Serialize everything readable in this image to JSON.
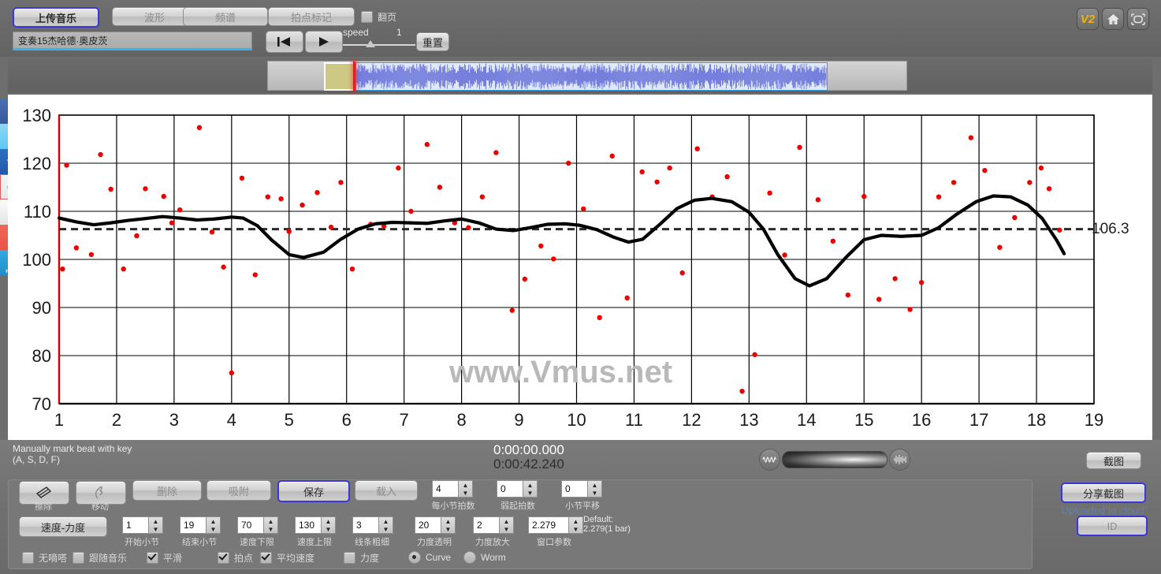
{
  "toolbar": {
    "buttons": [
      {
        "label": "上传音乐",
        "selected": true
      },
      {
        "label": "波形",
        "selected": false
      },
      {
        "label": "频谱",
        "selected": false
      },
      {
        "label": "拍点标记",
        "selected": false
      }
    ],
    "flip_checkbox": {
      "label": "翻页",
      "checked": false
    },
    "title_value": "变奏15杰哈德·奥皮茨",
    "speed_label": "speed",
    "speed_value": "1",
    "reset_label": "重置",
    "right_icons": [
      "v2-badge",
      "home-icon",
      "fullscreen-icon"
    ]
  },
  "social": [
    {
      "name": "facebook-icon",
      "glyph": "f"
    },
    {
      "name": "twitter-icon",
      "glyph": "t"
    },
    {
      "name": "qzone-icon",
      "glyph": "★"
    },
    {
      "name": "weibo-icon",
      "glyph": "◉"
    },
    {
      "name": "email-icon",
      "glyph": "✉"
    },
    {
      "name": "share-plus-icon",
      "glyph": "+"
    },
    {
      "name": "help-icon",
      "glyph": "?",
      "sub": "HELP"
    }
  ],
  "chart_data": {
    "type": "scatter",
    "title": "",
    "xlabel": "",
    "ylabel": "",
    "watermark": "www.Vmus.net",
    "xlim": [
      1,
      19
    ],
    "ylim": [
      70,
      130
    ],
    "xticks": [
      1,
      2,
      3,
      4,
      5,
      6,
      7,
      8,
      9,
      10,
      11,
      12,
      13,
      14,
      15,
      16,
      17,
      18,
      19
    ],
    "yticks": [
      70,
      80,
      90,
      100,
      110,
      120,
      130
    ],
    "grid": true,
    "average_line": {
      "value": 106.3,
      "label": "106.3",
      "style": "dashed"
    },
    "series": [
      {
        "name": "beat-tempo-points",
        "type": "scatter",
        "color": "#ee0000",
        "points": [
          [
            1.06,
            98.0
          ],
          [
            1.13,
            119.6
          ],
          [
            1.3,
            102.4
          ],
          [
            1.56,
            101.0
          ],
          [
            1.72,
            121.8
          ],
          [
            1.9,
            114.6
          ],
          [
            2.12,
            98.0
          ],
          [
            2.35,
            104.9
          ],
          [
            2.5,
            114.7
          ],
          [
            2.82,
            113.1
          ],
          [
            2.96,
            107.6
          ],
          [
            3.1,
            110.3
          ],
          [
            3.44,
            127.4
          ],
          [
            3.66,
            105.7
          ],
          [
            3.86,
            98.4
          ],
          [
            4.0,
            76.4
          ],
          [
            4.18,
            116.9
          ],
          [
            4.41,
            96.8
          ],
          [
            4.63,
            113.0
          ],
          [
            4.86,
            112.6
          ],
          [
            5.0,
            105.8
          ],
          [
            5.23,
            111.3
          ],
          [
            5.49,
            113.9
          ],
          [
            5.73,
            106.7
          ],
          [
            5.9,
            116.0
          ],
          [
            6.1,
            98.0
          ],
          [
            6.42,
            107.3
          ],
          [
            6.65,
            106.9
          ],
          [
            6.9,
            119.0
          ],
          [
            7.12,
            110.0
          ],
          [
            7.4,
            123.9
          ],
          [
            7.62,
            115.0
          ],
          [
            7.88,
            107.6
          ],
          [
            8.12,
            106.6
          ],
          [
            8.36,
            113.0
          ],
          [
            8.6,
            122.2
          ],
          [
            8.88,
            89.4
          ],
          [
            9.1,
            95.9
          ],
          [
            9.38,
            102.8
          ],
          [
            9.6,
            100.1
          ],
          [
            9.86,
            120.0
          ],
          [
            10.12,
            110.5
          ],
          [
            10.4,
            87.9
          ],
          [
            10.62,
            121.5
          ],
          [
            10.88,
            92.0
          ],
          [
            11.14,
            118.2
          ],
          [
            11.4,
            116.1
          ],
          [
            11.62,
            119.0
          ],
          [
            11.84,
            97.2
          ],
          [
            12.1,
            123.0
          ],
          [
            12.36,
            113.0
          ],
          [
            12.62,
            117.2
          ],
          [
            12.88,
            72.6
          ],
          [
            13.1,
            80.2
          ],
          [
            13.36,
            113.8
          ],
          [
            13.62,
            100.9
          ],
          [
            13.88,
            123.3
          ],
          [
            14.2,
            112.4
          ],
          [
            14.46,
            103.8
          ],
          [
            14.72,
            92.6
          ],
          [
            15.0,
            113.1
          ],
          [
            15.26,
            91.7
          ],
          [
            15.54,
            96.0
          ],
          [
            15.8,
            89.6
          ],
          [
            16.0,
            95.2
          ],
          [
            16.3,
            113.0
          ],
          [
            16.56,
            116.0
          ],
          [
            16.86,
            125.3
          ],
          [
            17.1,
            118.5
          ],
          [
            17.36,
            102.5
          ],
          [
            17.62,
            108.7
          ],
          [
            17.88,
            116.0
          ],
          [
            18.08,
            119.0
          ],
          [
            18.22,
            114.7
          ],
          [
            18.4,
            106.1
          ]
        ]
      },
      {
        "name": "smoothed-tempo-curve",
        "type": "line",
        "color": "#000000",
        "points": [
          [
            1.0,
            108.6
          ],
          [
            1.3,
            107.8
          ],
          [
            1.6,
            107.2
          ],
          [
            1.9,
            107.6
          ],
          [
            2.2,
            108.1
          ],
          [
            2.5,
            108.5
          ],
          [
            2.8,
            108.9
          ],
          [
            3.1,
            108.6
          ],
          [
            3.4,
            108.2
          ],
          [
            3.7,
            108.4
          ],
          [
            4.0,
            108.8
          ],
          [
            4.2,
            108.6
          ],
          [
            4.45,
            107.0
          ],
          [
            4.7,
            104.0
          ],
          [
            5.0,
            101.0
          ],
          [
            5.25,
            100.4
          ],
          [
            5.6,
            101.5
          ],
          [
            5.9,
            104.2
          ],
          [
            6.2,
            106.3
          ],
          [
            6.5,
            107.4
          ],
          [
            6.8,
            107.7
          ],
          [
            7.1,
            107.6
          ],
          [
            7.4,
            107.5
          ],
          [
            7.7,
            108.0
          ],
          [
            8.0,
            108.4
          ],
          [
            8.3,
            107.6
          ],
          [
            8.6,
            106.3
          ],
          [
            8.9,
            106.0
          ],
          [
            9.2,
            106.6
          ],
          [
            9.5,
            107.3
          ],
          [
            9.8,
            107.4
          ],
          [
            10.05,
            107.1
          ],
          [
            10.35,
            106.2
          ],
          [
            10.65,
            104.6
          ],
          [
            10.9,
            103.6
          ],
          [
            11.15,
            104.2
          ],
          [
            11.45,
            107.3
          ],
          [
            11.75,
            110.6
          ],
          [
            12.05,
            112.3
          ],
          [
            12.35,
            112.7
          ],
          [
            12.7,
            112.0
          ],
          [
            13.0,
            109.8
          ],
          [
            13.25,
            106.3
          ],
          [
            13.5,
            101.0
          ],
          [
            13.8,
            96.0
          ],
          [
            14.05,
            94.5
          ],
          [
            14.35,
            96.0
          ],
          [
            14.7,
            100.6
          ],
          [
            15.0,
            104.1
          ],
          [
            15.3,
            105.0
          ],
          [
            15.65,
            104.8
          ],
          [
            16.0,
            105.0
          ],
          [
            16.3,
            106.6
          ],
          [
            16.6,
            109.3
          ],
          [
            16.95,
            112.0
          ],
          [
            17.25,
            113.2
          ],
          [
            17.55,
            113.0
          ],
          [
            17.85,
            111.3
          ],
          [
            18.1,
            108.5
          ],
          [
            18.35,
            104.0
          ],
          [
            18.48,
            101.2
          ]
        ]
      }
    ]
  },
  "status": {
    "hint_line1": "Manually mark beat with key",
    "hint_line2": "(A, S, D, F)",
    "time_current": "0:00:00.000",
    "time_total": "0:00:42.240",
    "volume_left_icon": "waveform-smooth-icon",
    "volume_right_icon": "waveform-dense-icon",
    "snapshot_label": "截图"
  },
  "bottom": {
    "tools": [
      {
        "label": "擦除",
        "icon": "eraser-icon"
      },
      {
        "label": "移动",
        "icon": "hand-move-icon"
      }
    ],
    "actions": [
      {
        "label": "删除",
        "selected": false
      },
      {
        "label": "吸附",
        "selected": false
      },
      {
        "label": "保存",
        "selected": true
      },
      {
        "label": "载入",
        "selected": false
      }
    ],
    "velocity_button": "速度-力度",
    "spinners_row1": [
      {
        "value": "4",
        "caption": "每小节拍数"
      },
      {
        "value": "0",
        "caption": "弱起拍数"
      },
      {
        "value": "0",
        "caption": "小节平移"
      }
    ],
    "spinners_row2": [
      {
        "value": "1",
        "caption": "开始小节"
      },
      {
        "value": "19",
        "caption": "结束小节"
      },
      {
        "value": "70",
        "caption": "速度下限"
      },
      {
        "value": "130",
        "caption": "速度上限"
      },
      {
        "value": "3",
        "caption": "线条粗细"
      },
      {
        "value": "20",
        "caption": "力度透明"
      },
      {
        "value": "2",
        "caption": "力度放大"
      },
      {
        "value": "2.279",
        "caption": "窗口参数"
      }
    ],
    "default_note_line1": "Default:",
    "default_note_line2": "2.279(1 bar)",
    "checkboxes": [
      {
        "label": "无嘀嗒",
        "checked": false
      },
      {
        "label": "跟随音乐",
        "checked": false
      },
      {
        "label": "平滑",
        "checked": true
      },
      {
        "label": "拍点",
        "checked": true
      },
      {
        "label": "平均速度",
        "checked": true
      },
      {
        "label": "力度",
        "checked": false
      }
    ],
    "radios": [
      {
        "label": "Curve",
        "checked": true
      },
      {
        "label": "Worm",
        "checked": false
      }
    ],
    "share_button": "分享截图",
    "cloud_text": "Uploaded to cloud",
    "id_button": "ID"
  }
}
